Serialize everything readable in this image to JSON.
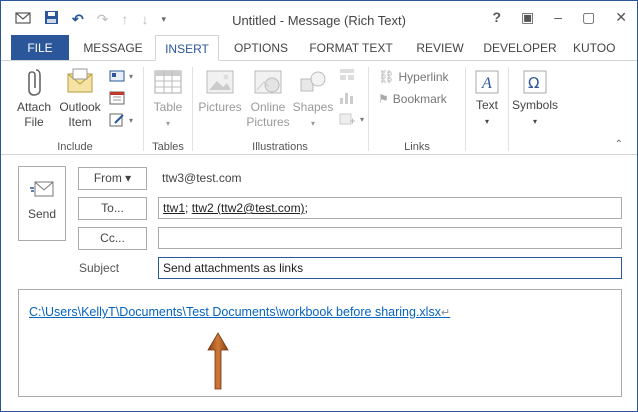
{
  "window": {
    "title": "Untitled - Message (Rich Text)",
    "controls": [
      "?",
      "▣",
      "–",
      "▢",
      "✕"
    ]
  },
  "tabs": [
    {
      "label": "FILE"
    },
    {
      "label": "MESSAGE"
    },
    {
      "label": "INSERT"
    },
    {
      "label": "OPTIONS"
    },
    {
      "label": "FORMAT TEXT"
    },
    {
      "label": "REVIEW"
    },
    {
      "label": "DEVELOPER"
    },
    {
      "label": "KUTOO"
    }
  ],
  "ribbon": {
    "include": {
      "label": "Include",
      "attach_file": [
        "Attach",
        "File"
      ],
      "outlook_item": [
        "Outlook",
        "Item"
      ]
    },
    "tables": {
      "label": "Tables",
      "table": "Table"
    },
    "illustrations": {
      "label": "Illustrations",
      "pictures": "Pictures",
      "online_pictures": [
        "Online",
        "Pictures"
      ],
      "shapes": "Shapes"
    },
    "links": {
      "label": "Links",
      "hyperlink": "Hyperlink",
      "bookmark": "Bookmark"
    },
    "text": {
      "label": "Text"
    },
    "symbols": {
      "label": "Symbols"
    }
  },
  "compose": {
    "send_label": "Send",
    "from_button": "From ▾",
    "from_value": "ttw3@test.com",
    "to_button": "To...",
    "to_recipient_1": "ttw1",
    "to_sep": "; ",
    "to_recipient_2": "ttw2 (ttw2@test.com)",
    "to_tail": ";",
    "cc_button": "Cc...",
    "cc_value": "",
    "subject_label": "Subject",
    "subject_value": "Send attachments as links",
    "body_link": "C:\\Users\\KellyT\\Documents\\Test Documents\\workbook before sharing.xlsx",
    "body_pilcrow": "↵"
  },
  "colors": {
    "accent": "#2b579a",
    "link": "#0563c1",
    "arrow": "#b35a1f"
  }
}
